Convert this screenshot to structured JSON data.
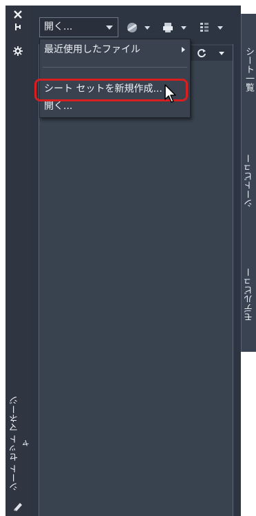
{
  "palette": {
    "panel_bg": "#2d3542",
    "content_bg": "#39424f",
    "strip_bg": "#2f3541",
    "highlight": "#d81e1e"
  },
  "strip": {
    "close_icon": "close-icon",
    "pin_icon": "pin-icon",
    "gear_icon": "gear-icon",
    "title": "シート セット マネージャ"
  },
  "toolbar": {
    "open_dropdown_value": "開く...",
    "icons": [
      "sheetset-properties-icon",
      "publish-icon",
      "view-options-icon"
    ]
  },
  "menu": {
    "recent": "最近使用したファイル",
    "new_sheet_set": "シート セットを新規作成...",
    "open": "開く..."
  },
  "tabs": {
    "sheet_list": "シート一覧",
    "sheet_views": "シートビュー",
    "model_views": "モデルビュー"
  }
}
